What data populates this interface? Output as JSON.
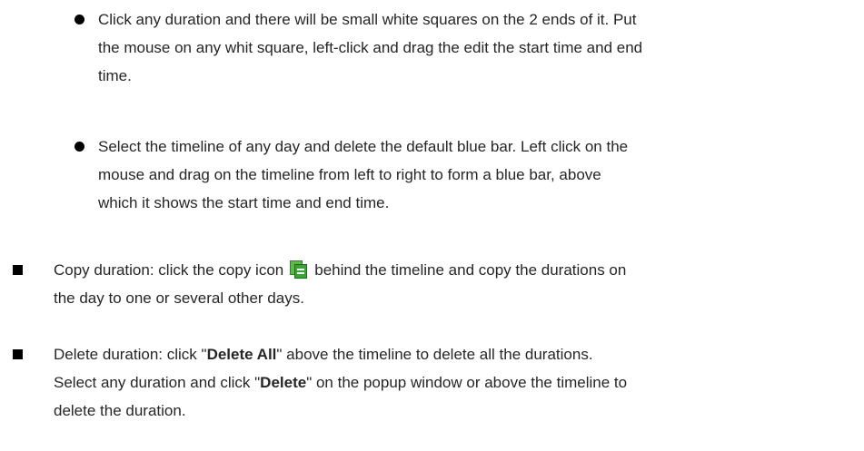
{
  "bullets": {
    "sub_1": {
      "line1": "Click any duration and there will be small white squares on the 2 ends of it. Put",
      "line2": "the mouse on any whit square, left-click and drag the edit the start time and end",
      "line3": "time."
    },
    "sub_2": {
      "line1": "Select the timeline of any day and delete the default blue bar. Left click on the",
      "line2": "mouse and drag on the timeline from left to right to form a blue bar, above",
      "line3": "which it shows the start time and end time."
    },
    "copy": {
      "before_icon": "Copy duration: click the copy icon",
      "after_icon": "behind the timeline and copy the durations on",
      "line2": "the day to one or several other days."
    },
    "delete": {
      "l1_part1": "Delete duration: click \"",
      "l1_bold": "Delete All",
      "l1_part2": "\" above the timeline to delete all the durations.",
      "l2_part1": "Select any duration and click \"",
      "l2_bold": "Delete",
      "l2_part2": "\" on the popup window or above the timeline to",
      "line3": "delete the duration."
    }
  },
  "icons": {
    "copy_icon": "copy-icon",
    "bullet_dot": "filled-circle",
    "bullet_square": "filled-square"
  },
  "colors": {
    "text": "#262626",
    "copy_icon_green": "#3da23a"
  }
}
